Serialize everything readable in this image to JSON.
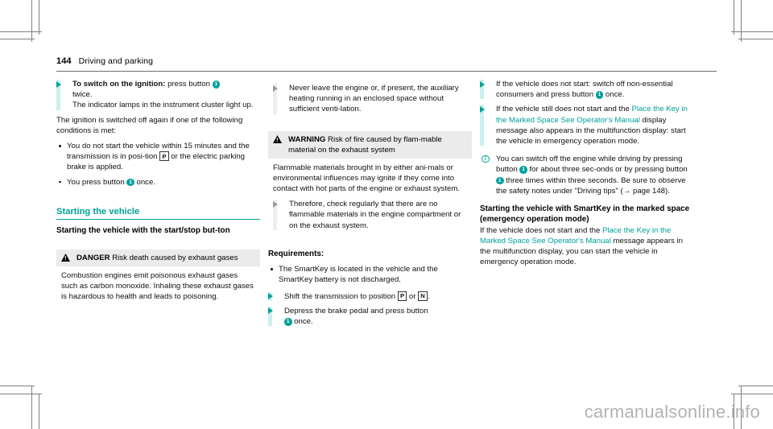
{
  "header": {
    "page_number": "144",
    "chapter": "Driving and parking"
  },
  "colors": {
    "accent_teal": "#00a19a",
    "step_bar": "#c9f0ee",
    "warning_head_bg": "#ebebeb",
    "gray_arrow": "#9a9a9a",
    "watermark": "#b3b3b3"
  },
  "column1": {
    "step1": {
      "lead": "To switch on the ignition:",
      "rest": " press button",
      "button": "1",
      "line2": "twice.",
      "line3": "The indicator lamps in the instrument cluster light up."
    },
    "para1": "The ignition is switched off again if one of the following conditions is met:",
    "bullet1_a": "You do not start the vehicle within 15 minutes and the transmission is in posi-tion ",
    "bullet1_gear": "P",
    "bullet1_b": " or the electric parking brake is applied.",
    "bullet2_a": "You press button ",
    "bullet2_button": "1",
    "bullet2_b": " once.",
    "heading2": "Starting the vehicle",
    "heading3": "Starting the vehicle with the start/stop but-ton",
    "danger": {
      "icon": "warning-triangle-icon",
      "label": "DANGER",
      "title": " Risk death caused by exhaust gases",
      "body": "Combustion engines emit poisonous exhaust gases such as carbon monoxide. Inhaling these exhaust gases is hazardous to health and leads to poisoning."
    }
  },
  "column2": {
    "step_never": "Never leave the engine or, if present, the auxiliary heating running in an enclosed space without sufficient venti-lation.",
    "warning": {
      "icon": "warning-triangle-icon",
      "label": "WARNING",
      "title": " Risk of fire caused by flam-mable material on the exhaust system",
      "body": "Flammable materials brought in by either ani-mals or environmental influences may ignite if they come into contact with hot parts of the engine or exhaust system.",
      "step": "Therefore, check regularly that there are no flammable materials in the engine compartment or on the exhaust system."
    },
    "requirements_label": "Requirements:",
    "requirement_bullet": "The SmartKey is located in the vehicle and the SmartKey battery is not discharged.",
    "step_shift_a": "Shift the transmission to position ",
    "step_shift_gear1": "P",
    "step_shift_mid": " or ",
    "step_shift_gear2": "N",
    "step_shift_b": ".",
    "step_brake_a": "Depress the brake pedal and press button ",
    "step_brake_button": "1",
    "step_brake_b": " once."
  },
  "column3": {
    "step_nostart_a": "If the vehicle does not start: switch off non-essential consumers and press button ",
    "step_nostart_button": "1",
    "step_nostart_b": " once.",
    "step_still_a": "If the vehicle still does not start and the ",
    "step_still_link": "Place the Key in the Marked Space See Operator's Manual",
    "step_still_b": " display message also appears in the multifunction display: start the vehicle in emergency operation mode.",
    "note": {
      "icon": "info-circle-icon",
      "text_a": "You can switch off the engine while driving by pressing button ",
      "button1": "1",
      "text_b": " for about three sec-onds or by pressing button ",
      "button2": "1",
      "text_c": " three times within three seconds. Be sure to observe the safety notes under \"Driving tips\" (→ page 148)."
    },
    "heading": "Starting the vehicle with SmartKey in the marked space (emergency operation mode)",
    "para_a": "If the vehicle does not start and the ",
    "para_link": "Place the Key in the Marked Space See Operator's Manual",
    "para_b": " message appears in the multifunction display, you can start the vehicle in emergency operation mode."
  },
  "watermark": "carmanualsonline.info"
}
